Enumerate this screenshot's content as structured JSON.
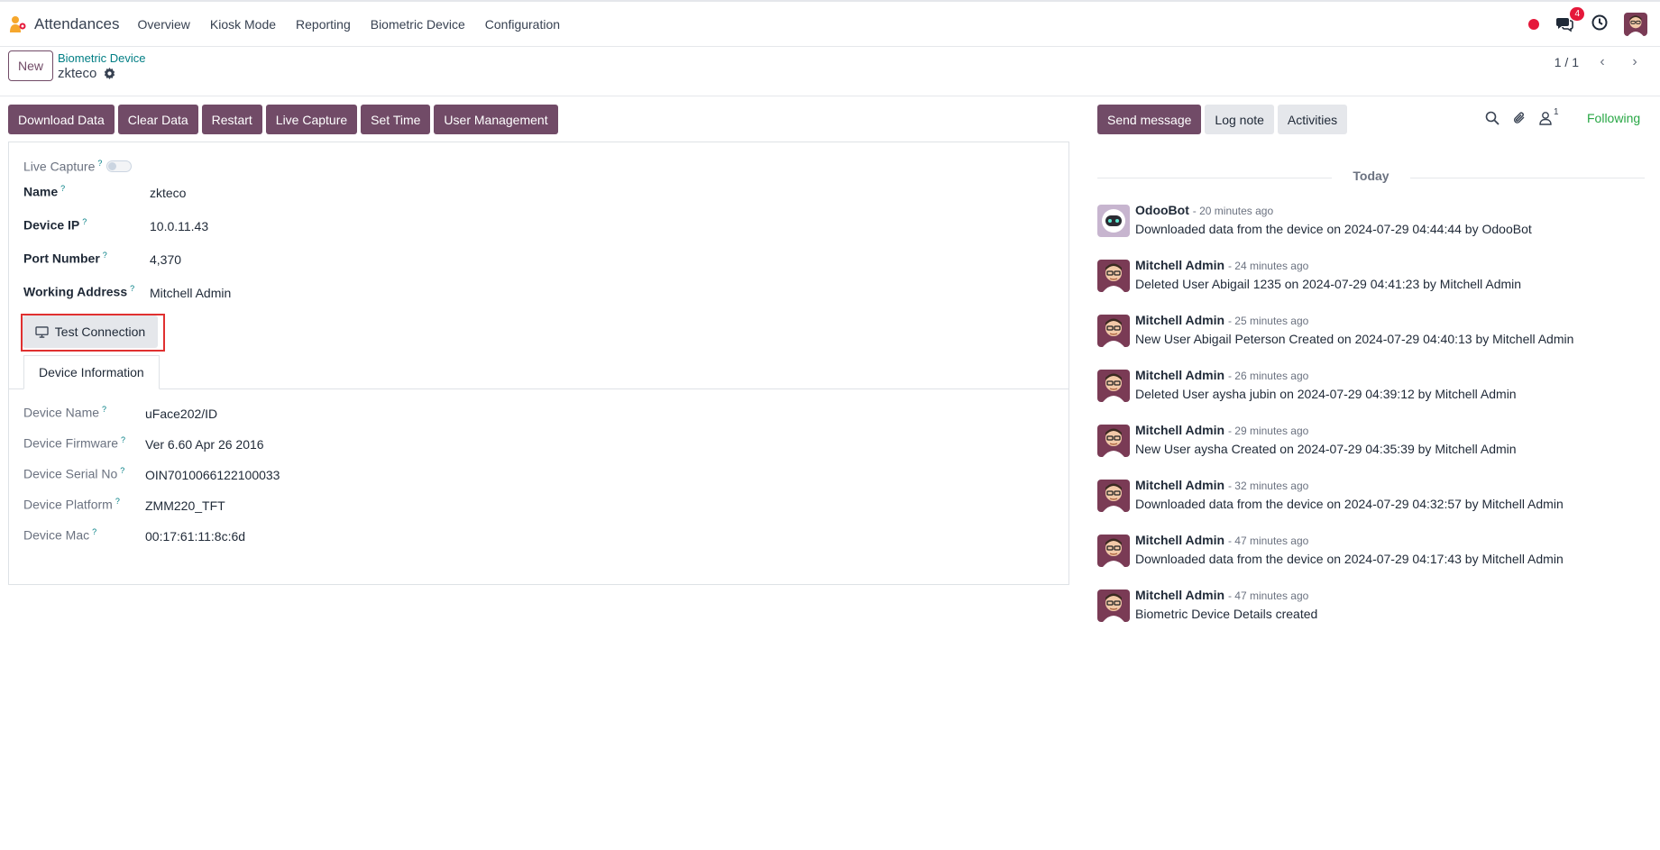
{
  "app": {
    "name": "Attendances",
    "menu": [
      "Overview",
      "Kiosk Mode",
      "Reporting",
      "Biometric Device",
      "Configuration"
    ],
    "messages_badge": "4"
  },
  "control_panel": {
    "new_label": "New",
    "breadcrumb_parent": "Biometric Device",
    "record_name": "zkteco",
    "pager": "1 / 1"
  },
  "actions": [
    "Download Data",
    "Clear Data",
    "Restart",
    "Live Capture",
    "Set Time",
    "User Management"
  ],
  "form": {
    "live_capture_label": "Live Capture",
    "name_label": "Name",
    "name_value": "zkteco",
    "ip_label": "Device IP",
    "ip_value": "10.0.11.43",
    "port_label": "Port Number",
    "port_value": "4,370",
    "address_label": "Working Address",
    "address_value": "Mitchell Admin",
    "test_connection_label": "Test Connection",
    "tab_label": "Device Information",
    "info": [
      {
        "label": "Device Name",
        "value": "uFace202/ID"
      },
      {
        "label": "Device Firmware",
        "value": "Ver 6.60 Apr 26 2016"
      },
      {
        "label": "Device Serial No",
        "value": "OIN7010066122100033"
      },
      {
        "label": "Device Platform",
        "value": "ZMM220_TFT"
      },
      {
        "label": "Device Mac",
        "value": "00:17:61:11:8c:6d"
      }
    ]
  },
  "chatter": {
    "send_message": "Send message",
    "log_note": "Log note",
    "activities": "Activities",
    "followers_count": "1",
    "following": "Following",
    "today": "Today",
    "messages": [
      {
        "author": "OdooBot",
        "time": "- 20 minutes ago",
        "body": "Downloaded data from the device on 2024-07-29 04:44:44 by OdooBot",
        "avatar": "bot"
      },
      {
        "author": "Mitchell Admin",
        "time": "- 24 minutes ago",
        "body": "Deleted User Abigail 1235 on 2024-07-29 04:41:23 by Mitchell Admin",
        "avatar": "admin"
      },
      {
        "author": "Mitchell Admin",
        "time": "- 25 minutes ago",
        "body": "New User Abigail Peterson Created on 2024-07-29 04:40:13 by Mitchell Admin",
        "avatar": "admin"
      },
      {
        "author": "Mitchell Admin",
        "time": "- 26 minutes ago",
        "body": "Deleted User aysha jubin on 2024-07-29 04:39:12 by Mitchell Admin",
        "avatar": "admin"
      },
      {
        "author": "Mitchell Admin",
        "time": "- 29 minutes ago",
        "body": "New User aysha Created on 2024-07-29 04:35:39 by Mitchell Admin",
        "avatar": "admin"
      },
      {
        "author": "Mitchell Admin",
        "time": "- 32 minutes ago",
        "body": "Downloaded data from the device on 2024-07-29 04:32:57 by Mitchell Admin",
        "avatar": "admin"
      },
      {
        "author": "Mitchell Admin",
        "time": "- 47 minutes ago",
        "body": "Downloaded data from the device on 2024-07-29 04:17:43 by Mitchell Admin",
        "avatar": "admin"
      },
      {
        "author": "Mitchell Admin",
        "time": "- 47 minutes ago",
        "body": "Biometric Device Details created",
        "avatar": "admin"
      }
    ]
  },
  "colors": {
    "primary": "#714b67",
    "link": "#017e84",
    "following": "#28a745",
    "badge": "#e5183a"
  }
}
